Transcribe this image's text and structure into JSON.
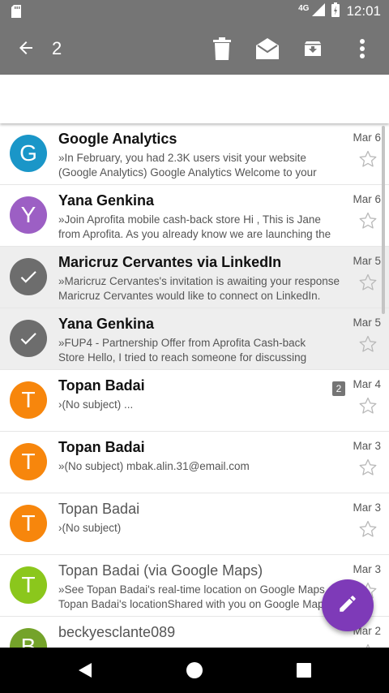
{
  "status_bar": {
    "time": "12:01",
    "network": "4G",
    "icons": [
      "sd-card-icon",
      "signal-icon",
      "battery-icon"
    ]
  },
  "action_bar": {
    "selected_count": "2",
    "icons": [
      "back-arrow-icon",
      "delete-icon",
      "mark-read-icon",
      "archive-icon",
      "more-vert-icon"
    ]
  },
  "colors": {
    "bar": "#757575",
    "fab": "#7e3ab8",
    "selected_row": "#eeeeee"
  },
  "emails": [
    {
      "initial": "G",
      "avatar_color": "#1a96c8",
      "selected": false,
      "unread": true,
      "sender": "Google Analytics",
      "date": "Mar 6",
      "snippet_line1": "»In February, you had 2.3K users visit your website",
      "snippet_line2": "(Google Analytics) Google Analytics Welcome to your"
    },
    {
      "initial": "Y",
      "avatar_color": "#9c5fc4",
      "selected": false,
      "unread": true,
      "sender": "Yana Genkina",
      "date": "Mar 6",
      "snippet_line1": "»Join Aprofita mobile cash-back store Hi , This is Jane",
      "snippet_line2": "from Aprofita. As you already know we are launching the"
    },
    {
      "initial": "",
      "avatar_color": "#6d6d6d",
      "selected": true,
      "unread": true,
      "sender": "Maricruz Cervantes via LinkedIn",
      "date": "Mar 5",
      "snippet_line1": "»Maricruz Cervantes's invitation is awaiting your response",
      "snippet_line2": "Maricruz Cervantes would like to connect on LinkedIn."
    },
    {
      "initial": "",
      "avatar_color": "#6d6d6d",
      "selected": true,
      "unread": true,
      "sender": "Yana Genkina",
      "date": "Mar 5",
      "snippet_line1": "»FUP4 - Partnership Offer from Aprofita Cash-back",
      "snippet_line2": "Store Hello, I tried to reach someone for discussing"
    },
    {
      "initial": "T",
      "avatar_color": "#f7860c",
      "selected": false,
      "unread": true,
      "sender": "Topan Badai",
      "date": "Mar 4",
      "badge": "2",
      "snippet_line1": "›(No subject) ...",
      "snippet_line2": ""
    },
    {
      "initial": "T",
      "avatar_color": "#f7860c",
      "selected": false,
      "unread": true,
      "sender": "Topan Badai",
      "date": "Mar 3",
      "snippet_line1": "»(No subject) mbak.alin.31@email.com",
      "snippet_line2": ""
    },
    {
      "initial": "T",
      "avatar_color": "#f7860c",
      "selected": false,
      "unread": false,
      "sender": "Topan Badai",
      "date": "Mar 3",
      "snippet_line1": "›(No subject)",
      "snippet_line2": ""
    },
    {
      "initial": "T",
      "avatar_color": "#8bc71c",
      "selected": false,
      "unread": false,
      "sender": "Topan Badai (via Google Maps)",
      "date": "Mar 3",
      "snippet_line1": "»See Topan Badai's real-time location on Google Maps",
      "snippet_line2": "Topan Badai's locationShared with you on Google Maps"
    },
    {
      "initial": "B",
      "avatar_color": "#74a32a",
      "selected": false,
      "unread": false,
      "sender": "beckyesclante089",
      "date": "Mar 2",
      "snippet_line1": "",
      "snippet_line2": ""
    }
  ],
  "fab": {
    "icon": "compose-pencil-icon"
  },
  "nav_bar": {
    "icons": [
      "nav-back-icon",
      "nav-home-icon",
      "nav-recents-icon"
    ]
  }
}
